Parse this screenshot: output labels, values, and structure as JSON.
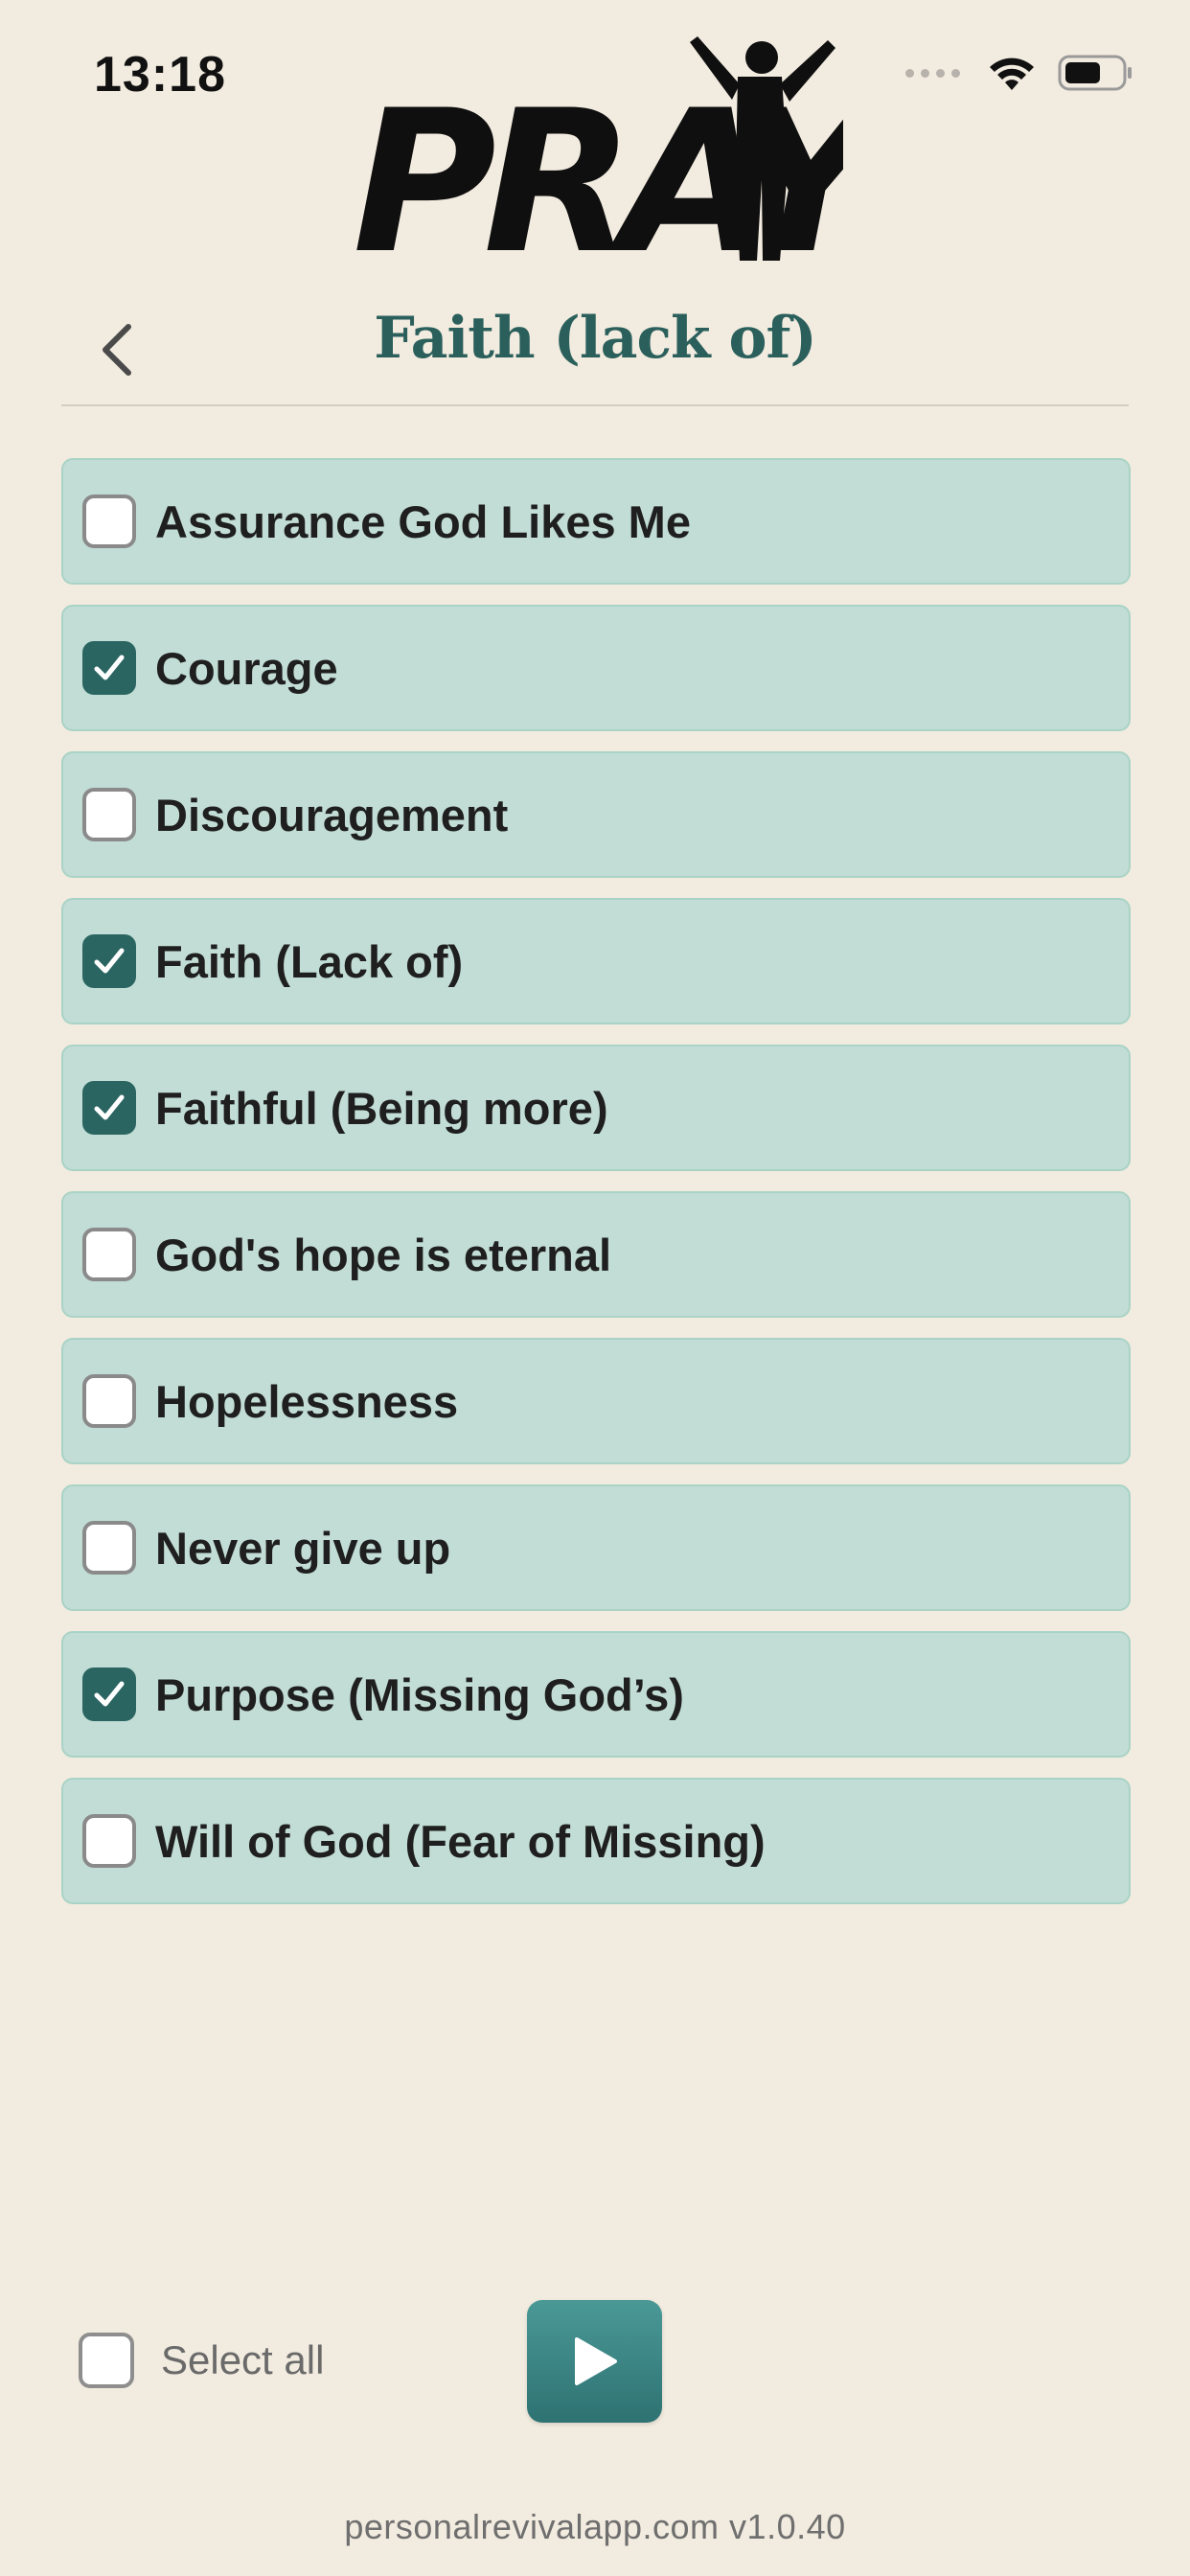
{
  "status_bar": {
    "time": "13:18"
  },
  "logo": {
    "text": "PRAY"
  },
  "header": {
    "title": "Faith (lack of)"
  },
  "topics": [
    {
      "label": "Assurance God Likes Me",
      "checked": false
    },
    {
      "label": "Courage",
      "checked": true
    },
    {
      "label": "Discouragement",
      "checked": false
    },
    {
      "label": "Faith (Lack of)",
      "checked": true
    },
    {
      "label": "Faithful (Being more)",
      "checked": true
    },
    {
      "label": "God's hope is eternal",
      "checked": false
    },
    {
      "label": "Hopelessness",
      "checked": false
    },
    {
      "label": "Never give up",
      "checked": false
    },
    {
      "label": "Purpose (Missing God’s)",
      "checked": true
    },
    {
      "label": "Will of God (Fear of Missing)",
      "checked": false
    }
  ],
  "controls": {
    "select_all_label": "Select all",
    "select_all_checked": false
  },
  "footer": {
    "text": "personalrevivalapp.com v1.0.40"
  },
  "colors": {
    "background": "#f2ebdf",
    "row_bg": "#c2ddd5",
    "accent": "#2a6562",
    "title": "#2a5f5c"
  },
  "icons": {
    "back": "chevron-left-icon",
    "play": "play-icon",
    "wifi": "wifi-icon",
    "battery": "battery-icon"
  }
}
